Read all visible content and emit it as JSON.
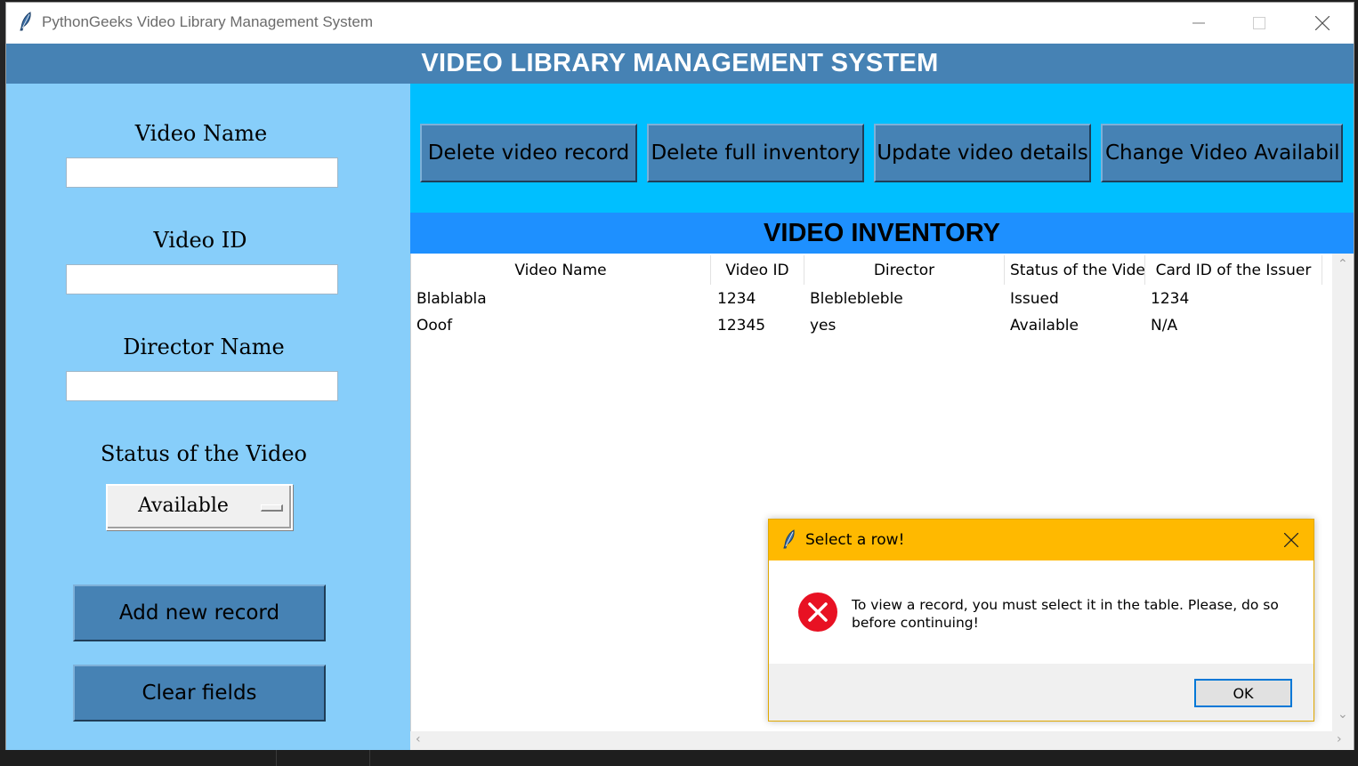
{
  "window": {
    "title": "PythonGeeks Video Library Management System"
  },
  "header": {
    "title": "VIDEO LIBRARY MANAGEMENT SYSTEM"
  },
  "form": {
    "video_name_label": "Video Name",
    "video_name_value": "",
    "video_id_label": "Video ID",
    "video_id_value": "",
    "director_label": "Director Name",
    "director_value": "",
    "status_label": "Status of the Video",
    "status_selected": "Available",
    "add_button": "Add new record",
    "clear_button": "Clear fields"
  },
  "toolbar": {
    "delete_record": "Delete video record",
    "delete_inventory": "Delete full inventory",
    "update_details": "Update video details",
    "change_availability": "Change Video Availability"
  },
  "inventory": {
    "title": "VIDEO INVENTORY",
    "columns": [
      "Video Name",
      "Video ID",
      "Director",
      "Status of the Videc",
      "Card ID of the Issuer"
    ],
    "rows": [
      [
        "Blablabla",
        "1234",
        "Bleblebleble",
        "Issued",
        "1234"
      ],
      [
        "Ooof",
        "12345",
        "yes",
        "Available",
        "N/A"
      ]
    ]
  },
  "dialog": {
    "title": "Select a row!",
    "message": "To view a record, you must select it in the table. Please, do so before continuing!",
    "ok_label": "OK"
  },
  "colors": {
    "header_bg": "#4682b4",
    "left_panel_bg": "#87cefa",
    "right_panel_bg": "#00bfff",
    "inventory_header_bg": "#1e90ff",
    "dialog_title_bg": "#ffb900",
    "error_icon": "#e81123"
  }
}
